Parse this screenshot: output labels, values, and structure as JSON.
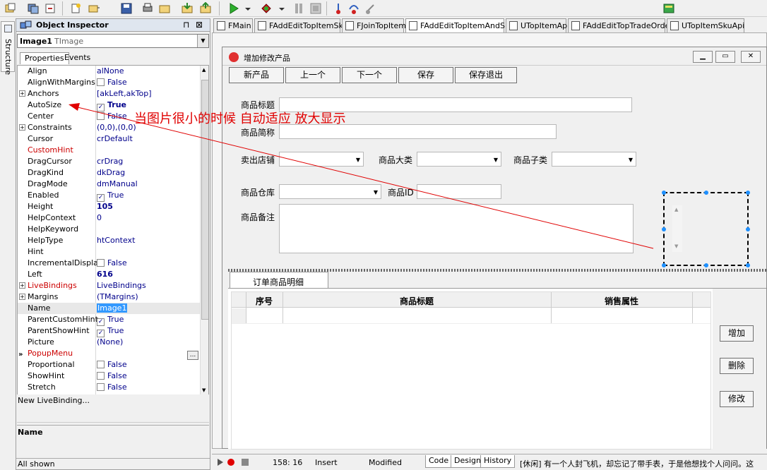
{
  "object_inspector": {
    "title": "Object Inspector",
    "pin_glyph": "⊓",
    "close_glyph": "⊠",
    "component_name": "Image1",
    "component_type": "TImage",
    "tabs": {
      "properties": "Properties",
      "events": "Events"
    },
    "properties": [
      {
        "name": "Align",
        "value": "alNone"
      },
      {
        "name": "AlignWithMargins",
        "value": "False",
        "checkbox": true,
        "checked": false
      },
      {
        "name": "Anchors",
        "value": "[akLeft,akTop]",
        "expandable": true
      },
      {
        "name": "AutoSize",
        "value": "True",
        "checkbox": true,
        "checked": true,
        "bold": true
      },
      {
        "name": "Center",
        "value": "False",
        "checkbox": true,
        "checked": false
      },
      {
        "name": "Constraints",
        "value": "(0,0),(0,0)",
        "expandable": true
      },
      {
        "name": "Cursor",
        "value": "crDefault"
      },
      {
        "name": "CustomHint",
        "value": "",
        "red": true
      },
      {
        "name": "DragCursor",
        "value": "crDrag"
      },
      {
        "name": "DragKind",
        "value": "dkDrag"
      },
      {
        "name": "DragMode",
        "value": "dmManual"
      },
      {
        "name": "Enabled",
        "value": "True",
        "checkbox": true,
        "checked": true
      },
      {
        "name": "Height",
        "value": "105",
        "bold": true
      },
      {
        "name": "HelpContext",
        "value": "0"
      },
      {
        "name": "HelpKeyword",
        "value": ""
      },
      {
        "name": "HelpType",
        "value": "htContext"
      },
      {
        "name": "Hint",
        "value": ""
      },
      {
        "name": "IncrementalDisplay",
        "value": "False",
        "checkbox": true,
        "checked": false
      },
      {
        "name": "Left",
        "value": "616",
        "bold": true
      },
      {
        "name": "LiveBindings",
        "value": "LiveBindings",
        "expandable": true,
        "red": true
      },
      {
        "name": "Margins",
        "value": "(TMargins)",
        "expandable": true
      },
      {
        "name": "Name",
        "value": "Image1",
        "selected": true
      },
      {
        "name": "ParentCustomHint",
        "value": "True",
        "checkbox": true,
        "checked": true
      },
      {
        "name": "ParentShowHint",
        "value": "True",
        "checkbox": true,
        "checked": true
      },
      {
        "name": "Picture",
        "value": "(None)"
      },
      {
        "name": "PopupMenu",
        "value": "",
        "red": true
      },
      {
        "name": "Proportional",
        "value": "False",
        "checkbox": true,
        "checked": false
      },
      {
        "name": "ShowHint",
        "value": "False",
        "checkbox": true,
        "checked": false
      },
      {
        "name": "Stretch",
        "value": "False",
        "checkbox": true,
        "checked": false
      }
    ],
    "livebinding_link": "New LiveBinding...",
    "description_title": "Name",
    "status": "All shown",
    "row_pointer": "»",
    "ellipsis": "..."
  },
  "structure_tab": "Structure",
  "editor_tabs": [
    "FMain",
    "FAddEditTopItemSku",
    "FJoinTopItem",
    "FAddEditTopItemAndSku",
    "UTopItemApi",
    "FAddEditTopTradeOrder",
    "UTopItemSkuApi"
  ],
  "form": {
    "title": "增加修改产品",
    "buttons": [
      "新产品",
      "上一个",
      "下一个",
      "保存",
      "保存退出"
    ],
    "labels": {
      "title": "商品标题",
      "short": "商品简称",
      "shop": "卖出店铺",
      "category": "商品大类",
      "subcategory": "商品子类",
      "warehouse": "商品仓库",
      "id": "商品ID",
      "notes": "商品备注"
    },
    "page_tab": "订单商品明细",
    "grid_headers": [
      "序号",
      "商品标题",
      "销售属性"
    ],
    "side_buttons": [
      "增加",
      "删除",
      "修改"
    ]
  },
  "annotation": "当图片很小的时候 自动适应 放大显示",
  "statusbar": {
    "position": "158:  16",
    "mode": "Insert",
    "state": "Modified",
    "tabs": [
      "Code",
      "Design",
      "History"
    ],
    "message": "[休闲] 有一个人封飞机，却忘记了带手表，于是他想找个人问问。这"
  },
  "colors": {
    "annotation": "#e00000",
    "selection": "#3399ff",
    "handle": "#1e90ff"
  }
}
